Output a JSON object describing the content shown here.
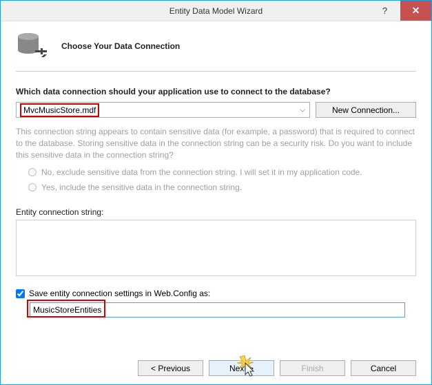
{
  "titlebar": {
    "title": "Entity Data Model Wizard",
    "help": "?",
    "close": "✕"
  },
  "header": {
    "title": "Choose Your Data Connection"
  },
  "prompt": "Which data connection should your application use to connect to the database?",
  "connection": {
    "selected": "MvcMusicStore.mdf",
    "new_button": "New Connection..."
  },
  "sensitive_warning": "This connection string appears to contain sensitive data (for example, a password) that is required to connect to the database. Storing sensitive data in the connection string can be a security risk. Do you want to include this sensitive data in the connection string?",
  "radios": {
    "exclude": "No, exclude sensitive data from the connection string. I will set it in my application code.",
    "include": "Yes, include the sensitive data in the connection string."
  },
  "conn_string_label": "Entity connection string:",
  "save_settings": {
    "checkbox_label": "Save entity connection settings in Web.Config as:",
    "value": "MusicStoreEntities"
  },
  "buttons": {
    "previous": "< Previous",
    "next": "Next >",
    "finish": "Finish",
    "cancel": "Cancel"
  }
}
